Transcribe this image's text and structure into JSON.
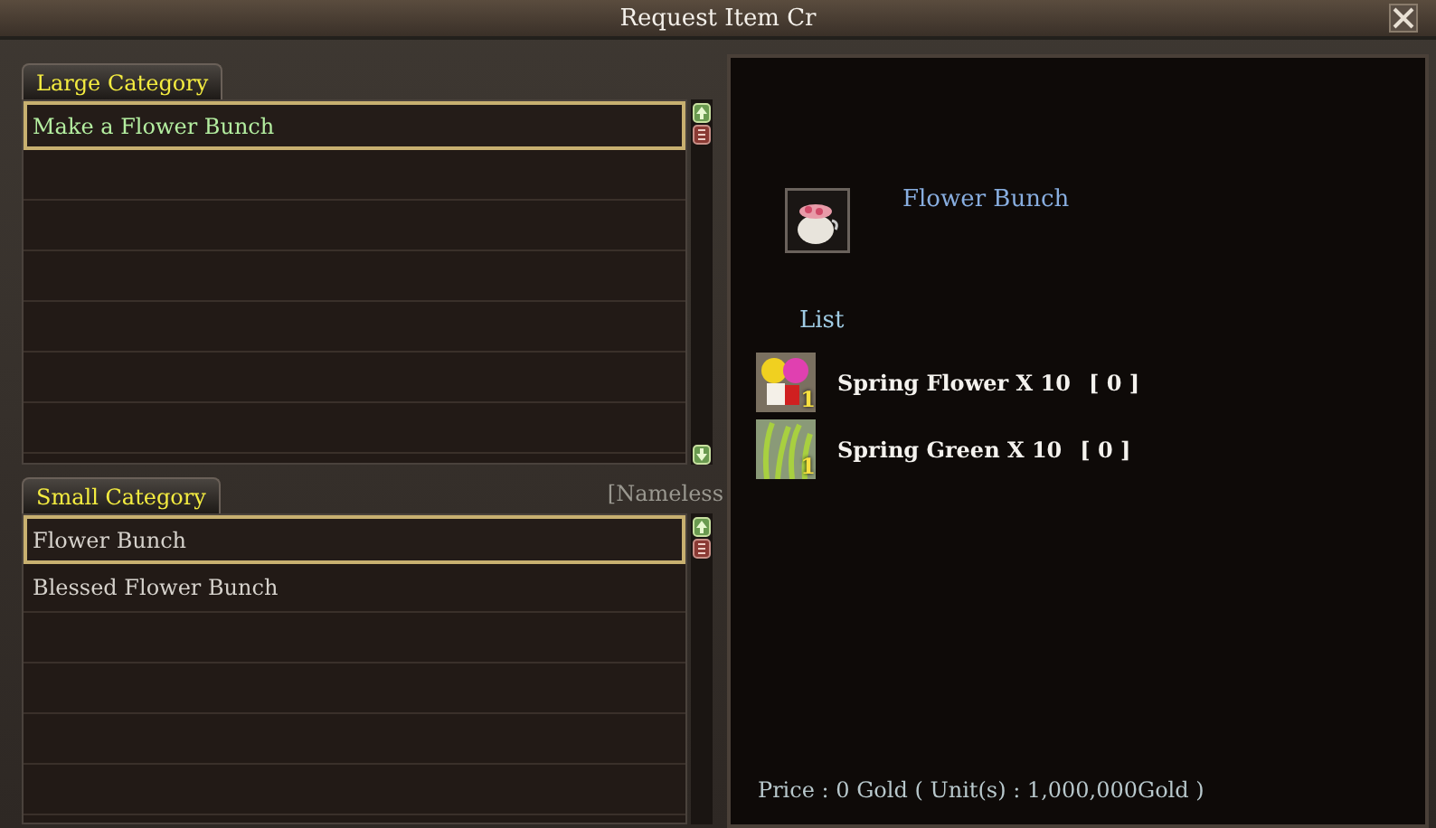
{
  "window": {
    "title": "Request Item Cr"
  },
  "large_category": {
    "tab": "Large Category",
    "items": [
      {
        "label": "Make a Flower Bunch",
        "selected": true
      }
    ]
  },
  "background_label": "[Nameless",
  "small_category": {
    "tab": "Small Category",
    "items": [
      {
        "label": "Flower Bunch",
        "selected": true
      },
      {
        "label": "Blessed Flower Bunch",
        "selected": false
      }
    ]
  },
  "detail": {
    "item_name": "Flower Bunch",
    "list_heading": "List",
    "materials": [
      {
        "kind": "flower",
        "count": "1",
        "name": "Spring Flower X 10",
        "owned": "[ 0 ]"
      },
      {
        "kind": "grass",
        "count": "1",
        "name": "Spring Green X 10",
        "owned": "[ 0 ]"
      }
    ],
    "price": "Price : 0 Gold ( Unit(s) : 1,000,000Gold )"
  }
}
